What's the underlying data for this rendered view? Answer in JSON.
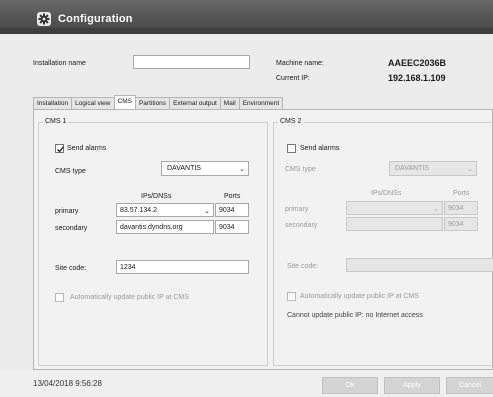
{
  "window": {
    "title": "Configuration"
  },
  "header": {
    "installation_name_label": "Installation name",
    "installation_name_value": "",
    "machine_name_label": "Machine name:",
    "machine_name_value": "AAEEC2036B",
    "current_ip_label": "Current IP:",
    "current_ip_value": "192.168.1.109"
  },
  "tabs": [
    {
      "label": "Installation"
    },
    {
      "label": "Logical view"
    },
    {
      "label": "CMS",
      "active": true
    },
    {
      "label": "Partitions"
    },
    {
      "label": "External output"
    },
    {
      "label": "Mail"
    },
    {
      "label": "Environment"
    }
  ],
  "cms1": {
    "title": "CMS 1",
    "send_alarms_label": "Send alarms",
    "send_alarms_checked": true,
    "cms_type_label": "CMS type",
    "cms_type_value": "DAVANTIS",
    "ips_header": "IPs/DNSs",
    "ports_header": "Ports",
    "primary_label": "primary",
    "primary_ip": "83.57.134.2",
    "primary_port": "9034",
    "secondary_label": "secondary",
    "secondary_ip": "davantis.dyndns.org",
    "secondary_port": "9034",
    "site_code_label": "Site code:",
    "site_code_value": "1234",
    "auto_update_label": "Automatically update public IP at CMS",
    "auto_update_checked": false
  },
  "cms2": {
    "title": "CMS 2",
    "send_alarms_label": "Send alarms",
    "send_alarms_checked": false,
    "cms_type_label": "CMS type",
    "cms_type_value": "DAVANTIS",
    "ips_header": "IPs/DNSs",
    "ports_header": "Ports",
    "primary_label": "primary",
    "primary_ip": "",
    "primary_port": "9034",
    "secondary_label": "secondary",
    "secondary_ip": "",
    "secondary_port": "9034",
    "site_code_label": "Site code:",
    "site_code_value": "",
    "auto_update_label": "Automatically update public IP at CMS",
    "auto_update_checked": false,
    "status_message": "Cannot update public IP: no Internet access"
  },
  "footer": {
    "datetime": "13/04/2018  9:56:28",
    "ok_label": "Ok",
    "apply_label": "Apply",
    "cancel_label": "Cancel"
  },
  "colors": {
    "titlebar": "#555555",
    "disabled_button": "#d4d4d4",
    "panel": "#f2f2f2"
  }
}
